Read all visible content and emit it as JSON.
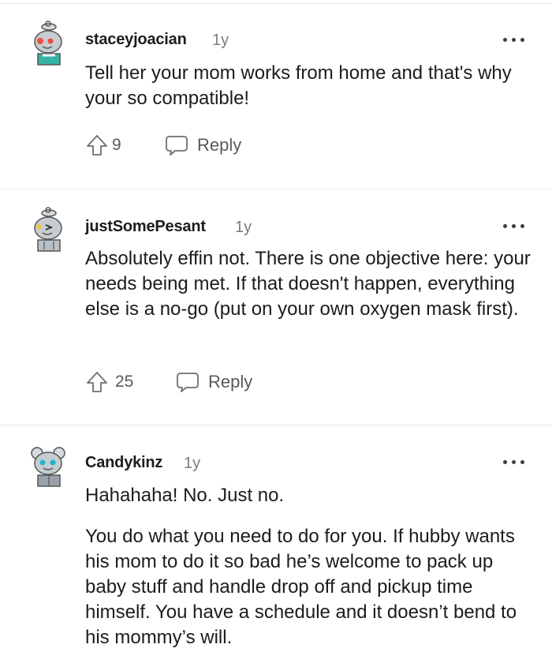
{
  "comments": [
    {
      "username": "staceyjoacian",
      "age": "1y",
      "paragraphs": [
        "Tell her your mom works from home and that's why your so compatible!"
      ],
      "upvotes": "9",
      "reply_label": "Reply",
      "avatar_accent": "#e8513f",
      "avatar_shirt": "#37b3a5"
    },
    {
      "username": "justSomePesant",
      "age": "1y",
      "paragraphs": [
        "Absolutely effin not. There is one objective here: your needs being met. If that doesn't happen, everything else is a no-go (put on your own oxygen mask first)."
      ],
      "upvotes": "25",
      "reply_label": "Reply",
      "avatar_accent": "#f2c230",
      "avatar_shirt": "#b8c0c7"
    },
    {
      "username": "Candykinz",
      "age": "1y",
      "paragraphs": [
        "Hahahaha! No. Just no.",
        "You do what you need to do for you. If hubby wants his mom to do it so bad he’s welcome to pack up baby stuff and handle drop off and pickup time himself. You have a schedule and it doesn’t bend to his mommy’s will."
      ],
      "avatar_accent": "#1fb5c9",
      "avatar_shirt": "#9aa3ab"
    }
  ]
}
